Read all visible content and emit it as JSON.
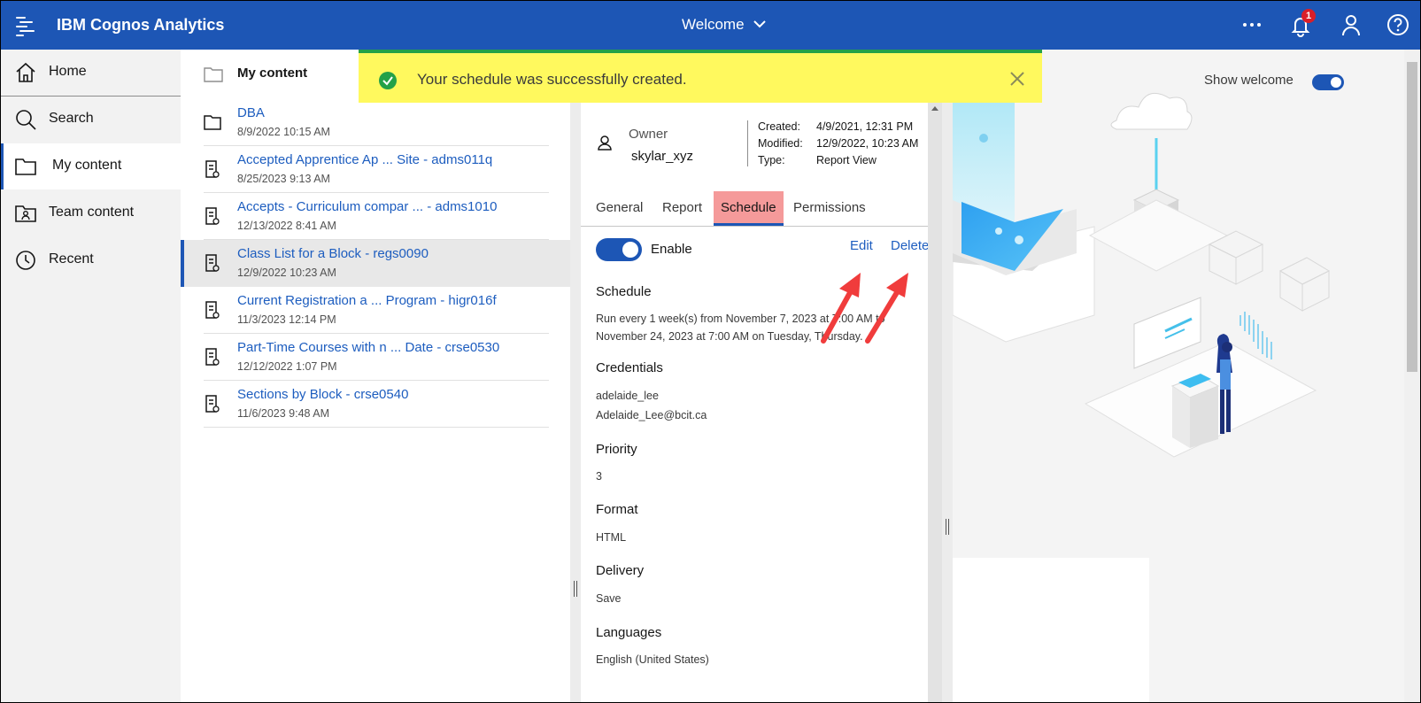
{
  "topbar": {
    "app_title": "IBM Cognos Analytics",
    "welcome_label": "Welcome",
    "notification_count": "1"
  },
  "leftnav": {
    "items": [
      {
        "label": "Home",
        "icon": "home-icon"
      },
      {
        "label": "Search",
        "icon": "search-icon"
      },
      {
        "label": "My content",
        "icon": "folder-icon"
      },
      {
        "label": "Team content",
        "icon": "team-folder-icon"
      },
      {
        "label": "Recent",
        "icon": "clock-icon"
      }
    ],
    "selected": "My content"
  },
  "content": {
    "title": "My content",
    "rows": [
      {
        "name": "DBA",
        "date": "8/9/2022 10:15 AM",
        "type": "folder"
      },
      {
        "name": "Accepted Apprentice Ap ... Site - adms011q",
        "date": "8/25/2023 9:13 AM",
        "type": "report-view"
      },
      {
        "name": "Accepts - Curriculum compar ... - adms1010",
        "date": "12/13/2022 8:41 AM",
        "type": "report-view"
      },
      {
        "name": "Class List for a Block - regs0090",
        "date": "12/9/2022 10:23 AM",
        "type": "report-view"
      },
      {
        "name": "Current Registration a ... Program - higr016f",
        "date": "11/3/2023 12:14 PM",
        "type": "report-view"
      },
      {
        "name": "Part-Time Courses with n ... Date - crse0530",
        "date": "12/12/2022 1:07 PM",
        "type": "report-view"
      },
      {
        "name": "Sections by Block - crse0540",
        "date": "11/6/2023 9:48 AM",
        "type": "report-view"
      }
    ]
  },
  "toast": {
    "message": "Your schedule was successfully created."
  },
  "properties": {
    "owner_label": "Owner",
    "owner_value": "skylar_xyz",
    "created_label": "Created:",
    "created_value": "4/9/2021, 12:31 PM",
    "modified_label": "Modified:",
    "modified_value": "12/9/2022, 10:23 AM",
    "type_label": "Type:",
    "type_value": "Report View",
    "tabs": [
      "General",
      "Report",
      "Schedule",
      "Permissions"
    ],
    "selected_tab": "Schedule",
    "enable_label": "Enable",
    "edit_label": "Edit",
    "delete_label": "Delete",
    "schedule_heading": "Schedule",
    "schedule_text": "Run every 1 week(s) from November 7, 2023 at 7:00 AM to November 24, 2023 at 7:00 AM on Tuesday, Thursday.",
    "credentials_heading": "Credentials",
    "credentials_user": "adelaide_lee",
    "credentials_email": "Adelaide_Lee@bcit.ca",
    "priority_heading": "Priority",
    "priority_value": "3",
    "format_heading": "Format",
    "format_value": "HTML",
    "delivery_heading": "Delivery",
    "delivery_value": "Save",
    "languages_heading": "Languages",
    "languages_value": "English (United States)"
  },
  "welcome_panel": {
    "show_welcome_label": "Show welcome"
  },
  "colors": {
    "brand_blue": "#1d56b5",
    "link_blue": "#1d5dbf",
    "toast_yellow": "#fff95e",
    "success_green": "#24a148",
    "annotation_red": "#f03c3c",
    "tab_highlight": "#f59a9a"
  }
}
